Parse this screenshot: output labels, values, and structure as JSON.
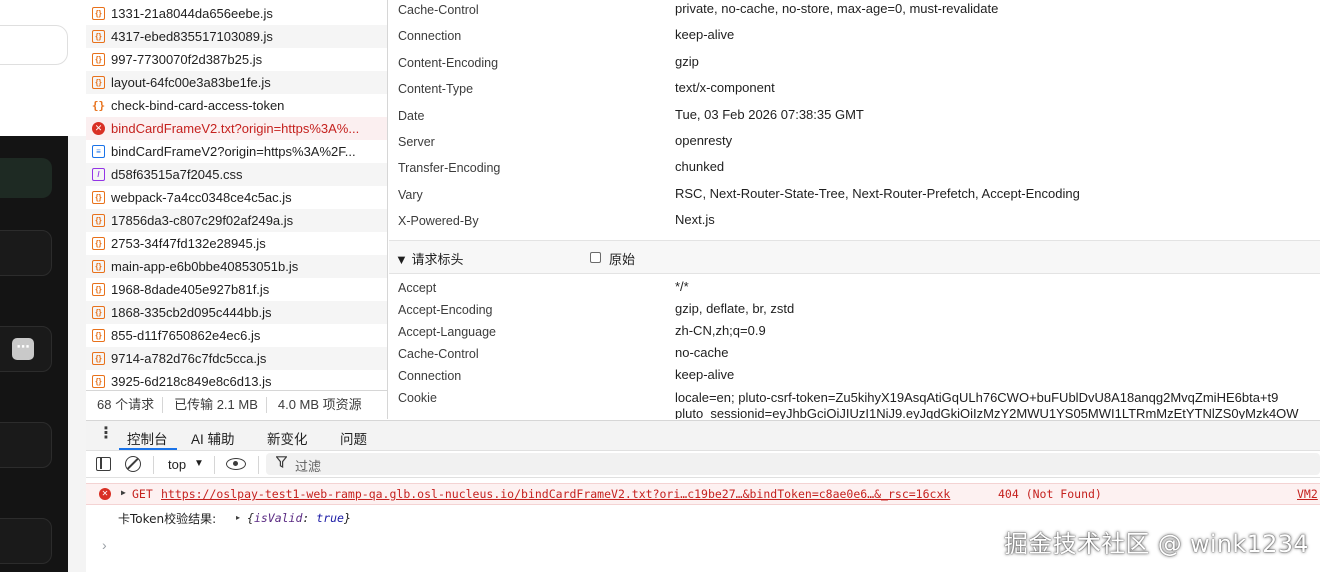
{
  "request_list": [
    {
      "name": "1331-21a8044da656eebe.js",
      "type": "js",
      "icon": "js-file-icon"
    },
    {
      "name": "4317-ebed835517103089.js",
      "type": "js",
      "icon": "js-file-icon"
    },
    {
      "name": "997-7730070f2d387b25.js",
      "type": "js",
      "icon": "js-file-icon"
    },
    {
      "name": "layout-64fc00e3a83be1fe.js",
      "type": "js",
      "icon": "js-file-icon"
    },
    {
      "name": "check-bind-card-access-token",
      "type": "fetch",
      "icon": "fetch-icon"
    },
    {
      "name": "bindCardFrameV2.txt?origin=https%3A%...",
      "type": "error",
      "icon": "error-icon"
    },
    {
      "name": "bindCardFrameV2?origin=https%3A%2F...",
      "type": "doc",
      "icon": "document-icon"
    },
    {
      "name": "d58f63515a7f2045.css",
      "type": "css",
      "icon": "css-file-icon"
    },
    {
      "name": "webpack-7a4cc0348ce4c5ac.js",
      "type": "js",
      "icon": "js-file-icon"
    },
    {
      "name": "17856da3-c807c29f02af249a.js",
      "type": "js",
      "icon": "js-file-icon"
    },
    {
      "name": "2753-34f47fd132e28945.js",
      "type": "js",
      "icon": "js-file-icon"
    },
    {
      "name": "main-app-e6b0bbe40853051b.js",
      "type": "js",
      "icon": "js-file-icon"
    },
    {
      "name": "1968-8dade405e927b81f.js",
      "type": "js",
      "icon": "js-file-icon"
    },
    {
      "name": "1868-335cb2d095c444bb.js",
      "type": "js",
      "icon": "js-file-icon"
    },
    {
      "name": "855-d11f7650862e4ec6.js",
      "type": "js",
      "icon": "js-file-icon"
    },
    {
      "name": "9714-a782d76c7fdc5cca.js",
      "type": "js",
      "icon": "js-file-icon"
    },
    {
      "name": "3925-6d218c849e8c6d13.js",
      "type": "js",
      "icon": "js-file-icon"
    }
  ],
  "summary": {
    "requests": "68 个请求",
    "transferred": "已传输 2.1 MB",
    "resources": "4.0 MB 项资源"
  },
  "response_headers": [
    {
      "key": "Cache-Control",
      "value": "private, no-cache, no-store, max-age=0, must-revalidate"
    },
    {
      "key": "Connection",
      "value": "keep-alive"
    },
    {
      "key": "Content-Encoding",
      "value": "gzip"
    },
    {
      "key": "Content-Type",
      "value": "text/x-component"
    },
    {
      "key": "Date",
      "value": "Tue, 03 Feb 2026 07:38:35 GMT"
    },
    {
      "key": "Server",
      "value": "openresty"
    },
    {
      "key": "Transfer-Encoding",
      "value": "chunked"
    },
    {
      "key": "Vary",
      "value": "RSC, Next-Router-State-Tree, Next-Router-Prefetch, Accept-Encoding"
    },
    {
      "key": "X-Powered-By",
      "value": "Next.js"
    }
  ],
  "request_headers_section": {
    "title": "▼ 请求标头",
    "raw_label": "原始"
  },
  "request_headers": [
    {
      "key": "Accept",
      "value": "*/*"
    },
    {
      "key": "Accept-Encoding",
      "value": "gzip, deflate, br, zstd"
    },
    {
      "key": "Accept-Language",
      "value": "zh-CN,zh;q=0.9"
    },
    {
      "key": "Cache-Control",
      "value": "no-cache"
    },
    {
      "key": "Connection",
      "value": "keep-alive"
    }
  ],
  "cookie": {
    "key": "Cookie",
    "line1": "locale=en; pluto-csrf-token=Zu5kihyX19AsqAtiGqULh76CWO+buFUblDvU8A18anqg2MvqZmiHE6bta+t9",
    "line2": "pluto_sessionid=eyJhbGciOiJIUzI1NiJ9.eyJqdGkiOiIzMzY2MWU1YS05MWI1LTRmMzEtYTNlZS0yMzk4OW"
  },
  "drawer": {
    "kebab": "⋮",
    "tabs": [
      "控制台",
      "AI 辅助",
      "新变化",
      "问题"
    ],
    "active_tab": "控制台"
  },
  "console_toolbar": {
    "context": "top",
    "context_caret": "▼",
    "filter_icon": "filter-icon",
    "filter_placeholder": "过滤"
  },
  "console": {
    "error_caret": "▶",
    "error_method": "GET",
    "error_url": "https://oslpay-test1-web-ramp-qa.glb.osl-nucleus.io/bindCardFrameV2.txt?ori…c19be27…&bindToken=c8ae0e6…&_rsc=16cxk",
    "error_status": "404 (Not Found)",
    "error_source": "VM2",
    "log_label": "卡Token校验结果:",
    "log_caret": "▸",
    "log_object_open": "{",
    "log_object_key": "isValid",
    "log_object_sep": ": ",
    "log_object_value": "true",
    "log_object_close": "}",
    "prompt": "›"
  },
  "left_strip": {
    "more_button": "⋯"
  },
  "watermark": "掘金技术社区 @ wink1234",
  "colors": {
    "error_red": "#c5221f",
    "error_bg": "#fdf1f1",
    "active_tab_blue": "#1a73e8",
    "js_orange": "#e8711a",
    "css_purple": "#9334e6"
  }
}
